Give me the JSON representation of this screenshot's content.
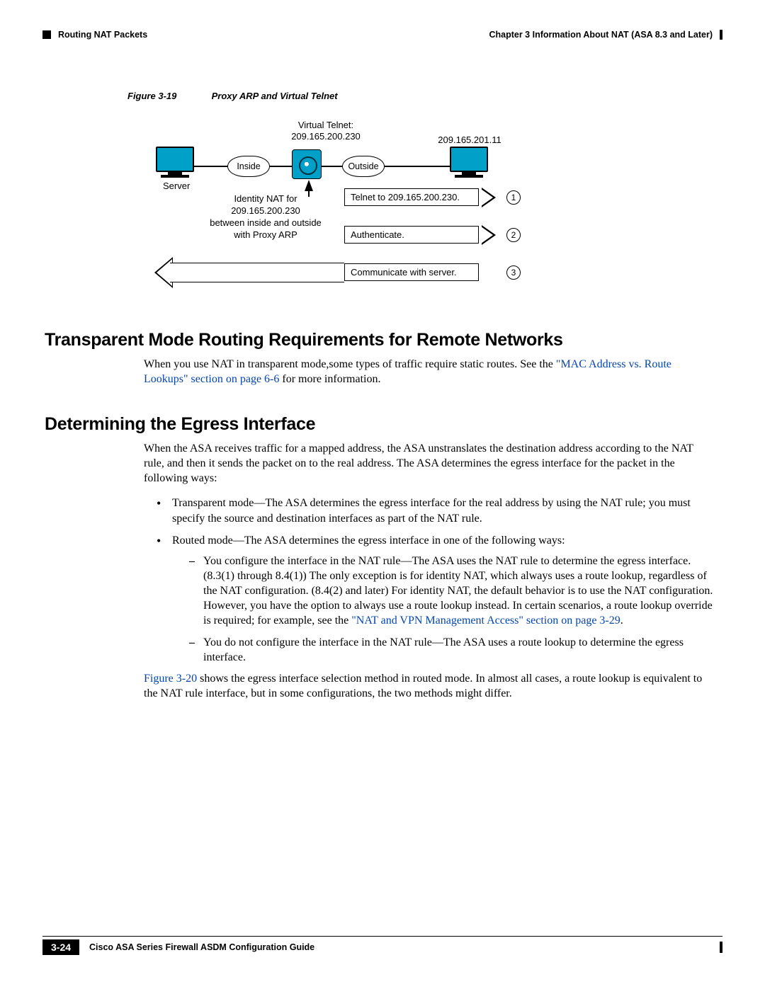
{
  "header": {
    "chapter": "Chapter 3      Information About NAT (ASA 8.3 and Later)",
    "section": "Routing NAT Packets"
  },
  "figure": {
    "label": "Figure 3-19",
    "title": "Proxy ARP and Virtual Telnet"
  },
  "diagram": {
    "virtual_telnet_line1": "Virtual Telnet:",
    "virtual_telnet_line2": "209.165.200.230",
    "ip_outside": "209.165.201.11",
    "server": "Server",
    "inside": "Inside",
    "outside": "Outside",
    "identity_l1": "Identity NAT for",
    "identity_l2": "209.165.200.230",
    "identity_l3": "between inside and outside",
    "identity_l4": "with Proxy ARP",
    "step1": "Telnet to 209.165.200.230.",
    "step2": "Authenticate.",
    "step3": "Communicate with server.",
    "n1": "1",
    "n2": "2",
    "n3": "3"
  },
  "section1": {
    "heading": "Transparent Mode Routing Requirements for Remote Networks",
    "p_pre": "When you use NAT in transparent mode,some types of traffic require static routes. See the ",
    "link": "\"MAC Address vs. Route Lookups\" section on page 6-6",
    "p_post": " for more information."
  },
  "section2": {
    "heading": "Determining the Egress Interface",
    "intro": "When the ASA receives traffic for a mapped address, the ASA unstranslates the destination address according to the NAT rule, and then it sends the packet on to the real address. The ASA determines the egress interface for the packet in the following ways:",
    "b1": "Transparent mode—The ASA determines the egress interface for the real address by using the NAT rule; you must specify the source and destination interfaces as part of the NAT rule.",
    "b2": "Routed mode—The ASA determines the egress interface in one of the following ways:",
    "d1_pre": "You configure the interface in the NAT rule—The ASA uses the NAT rule to determine the egress interface. (8.3(1) through 8.4(1)) The only exception is for identity NAT, which always uses a route lookup, regardless of the NAT configuration. (8.4(2) and later) For identity NAT, the default behavior is to use the NAT configuration. However, you have the option to always use a route lookup instead. In certain scenarios, a route lookup override is required; for example, see the ",
    "d1_link": "\"NAT and VPN Management Access\" section on page 3-29",
    "d1_post": ".",
    "d2": "You do not configure the interface in the NAT rule—The ASA uses a route lookup to determine the egress interface.",
    "final_link": "Figure 3-20",
    "final": " shows the egress interface selection method in routed mode. In almost all cases, a route lookup is equivalent to the NAT rule interface, but in some configurations, the two methods might differ."
  },
  "footer": {
    "guide": "Cisco ASA Series Firewall ASDM Configuration Guide",
    "page": "3-24"
  }
}
